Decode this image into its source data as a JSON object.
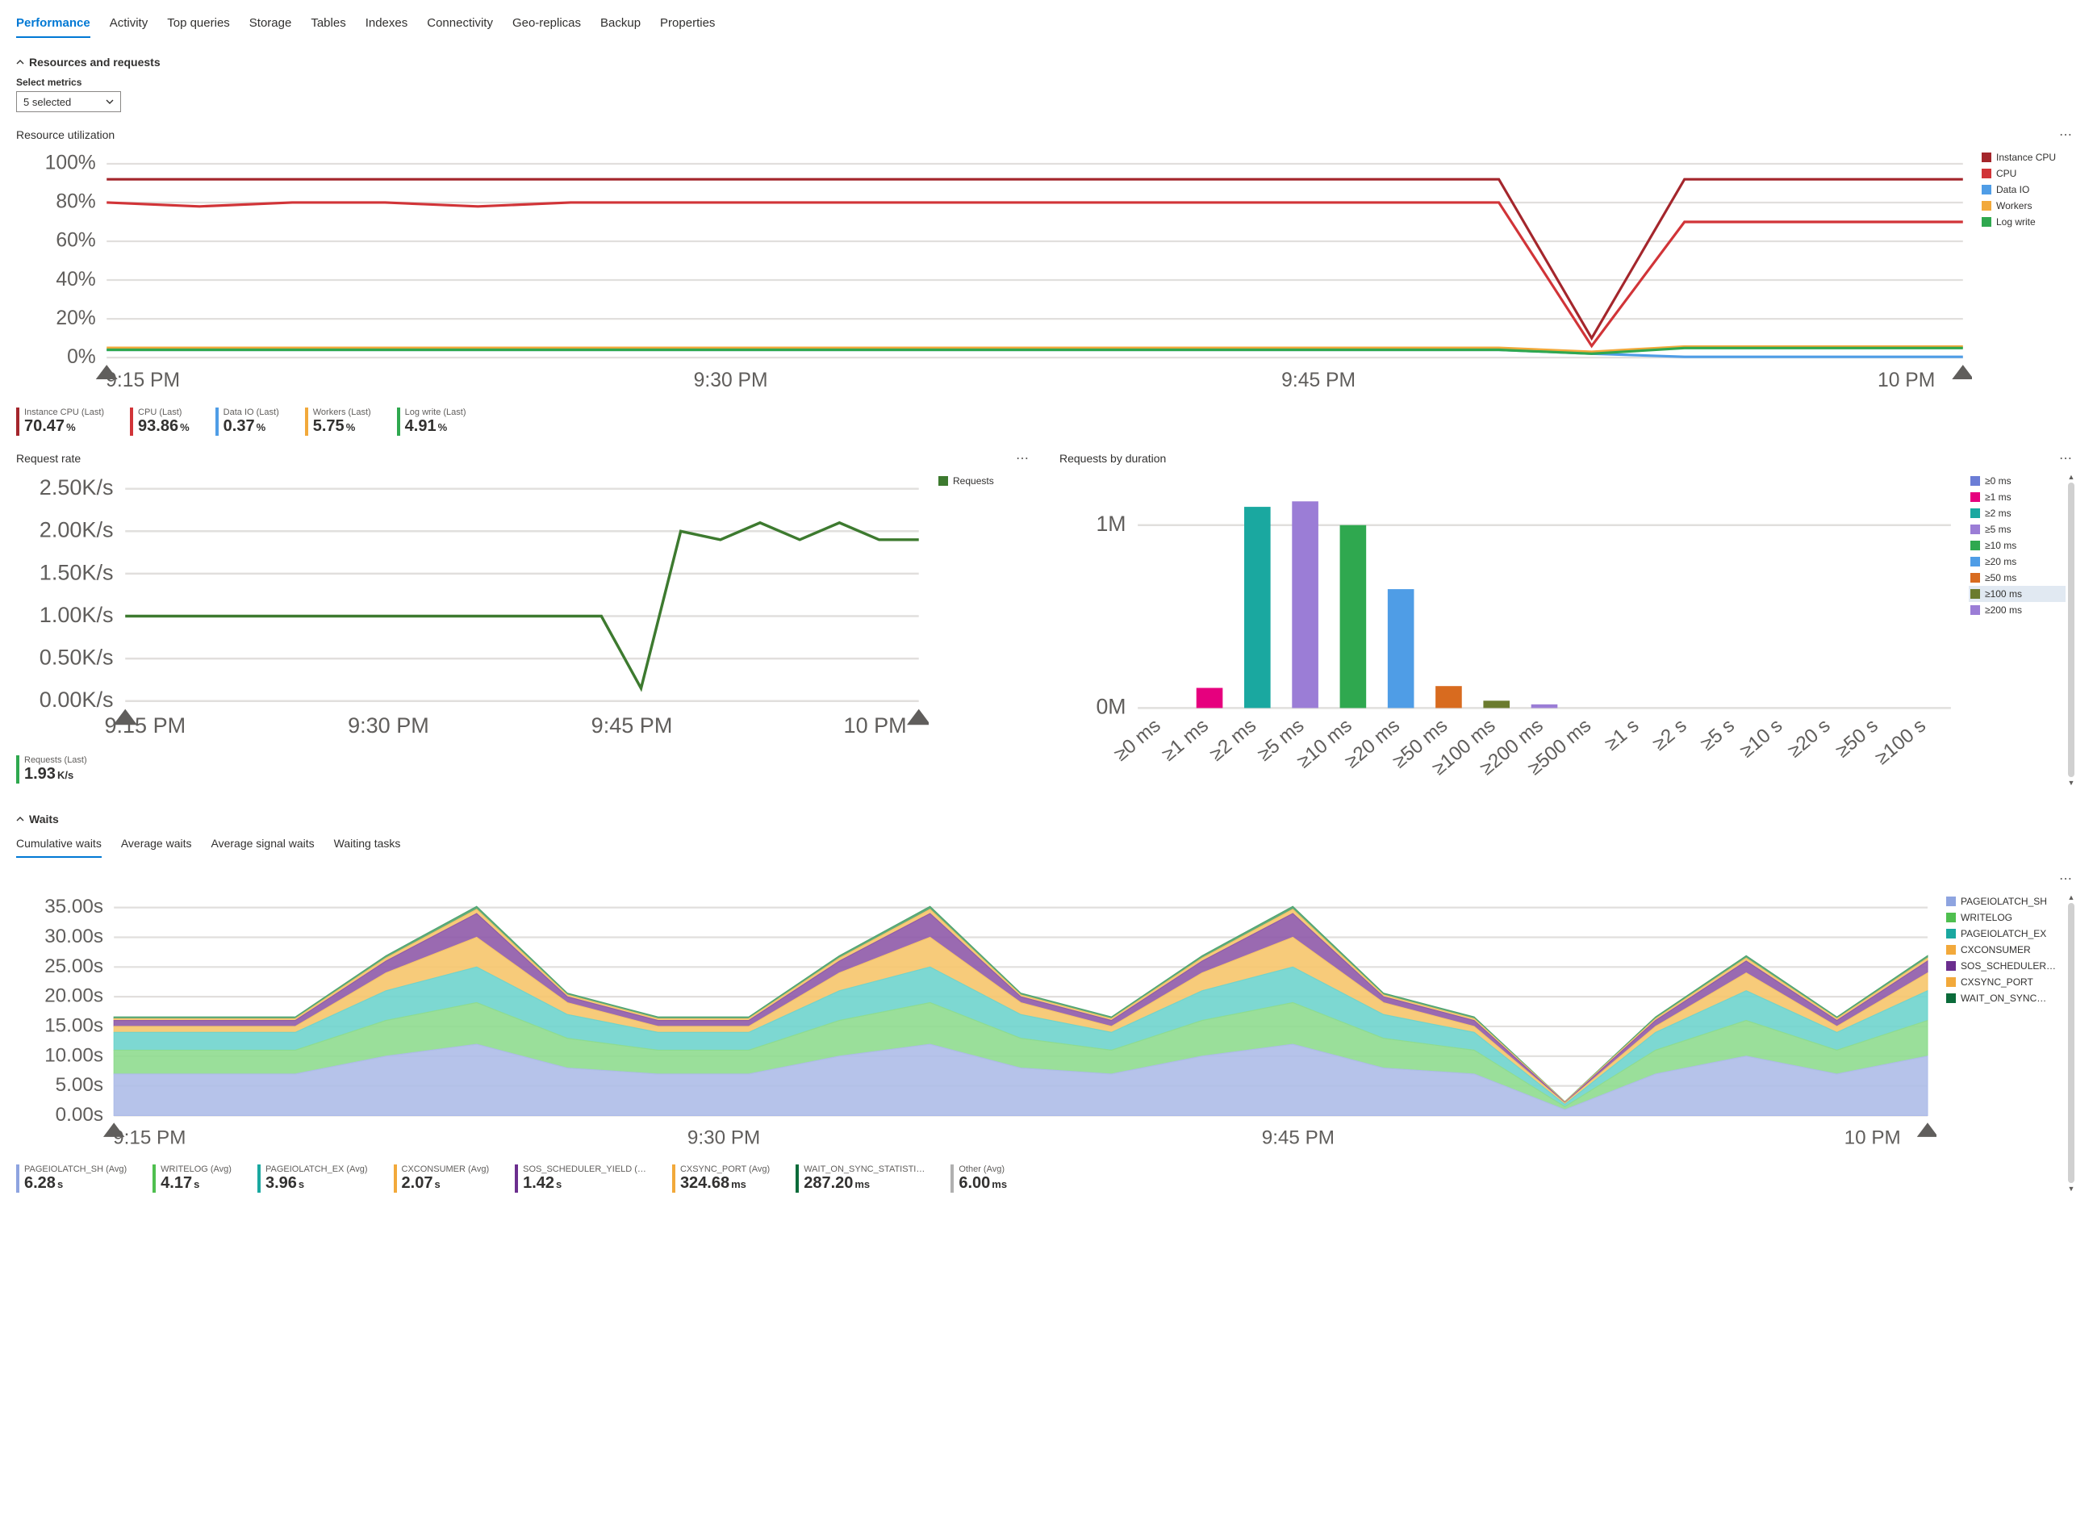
{
  "tabs": [
    "Performance",
    "Activity",
    "Top queries",
    "Storage",
    "Tables",
    "Indexes",
    "Connectivity",
    "Geo-replicas",
    "Backup",
    "Properties"
  ],
  "active_tab": "Performance",
  "section_resources": {
    "title": "Resources and requests",
    "select_label": "Select metrics",
    "select_value": "5 selected"
  },
  "resource_util": {
    "title": "Resource utilization",
    "x_ticks": [
      "9:15 PM",
      "9:30 PM",
      "9:45 PM",
      "10 PM"
    ],
    "legend": [
      {
        "name": "Instance CPU",
        "color": "#a4262c"
      },
      {
        "name": "CPU",
        "color": "#d13438"
      },
      {
        "name": "Data IO",
        "color": "#4f9de6"
      },
      {
        "name": "Workers",
        "color": "#f2a93b"
      },
      {
        "name": "Log write",
        "color": "#2fa84f"
      }
    ],
    "ylabels": [
      "100%",
      "80%",
      "60%",
      "40%",
      "20%",
      "0%"
    ],
    "kpis": [
      {
        "label": "Instance CPU (Last)",
        "value": "70.47",
        "unit": "%",
        "color": "#a4262c"
      },
      {
        "label": "CPU (Last)",
        "value": "93.86",
        "unit": "%",
        "color": "#d13438"
      },
      {
        "label": "Data IO (Last)",
        "value": "0.37",
        "unit": "%",
        "color": "#4f9de6"
      },
      {
        "label": "Workers (Last)",
        "value": "5.75",
        "unit": "%",
        "color": "#f2a93b"
      },
      {
        "label": "Log write (Last)",
        "value": "4.91",
        "unit": "%",
        "color": "#2fa84f"
      }
    ]
  },
  "request_rate": {
    "title": "Request rate",
    "x_ticks": [
      "9:15 PM",
      "9:30 PM",
      "9:45 PM",
      "10 PM"
    ],
    "ylabels": [
      "2.50K/s",
      "2.00K/s",
      "1.50K/s",
      "1.00K/s",
      "0.50K/s",
      "0.00K/s"
    ],
    "legend": [
      {
        "name": "Requests",
        "color": "#3d7a2f"
      }
    ],
    "kpis": [
      {
        "label": "Requests (Last)",
        "value": "1.93",
        "unit": "K/s",
        "color": "#2fa84f"
      }
    ]
  },
  "requests_by_duration": {
    "title": "Requests by duration",
    "ylabels": [
      "1M",
      "0M"
    ],
    "categories": [
      "≥0 ms",
      "≥1 ms",
      "≥2 ms",
      "≥5 ms",
      "≥10 ms",
      "≥20 ms",
      "≥50 ms",
      "≥100 ms",
      "≥200 ms",
      "≥500 ms",
      "≥1 s",
      "≥2 s",
      "≥5 s",
      "≥10 s",
      "≥20 s",
      "≥50 s",
      "≥100 s"
    ],
    "legend": [
      {
        "name": "≥0 ms",
        "color": "#6b7dd6"
      },
      {
        "name": "≥1 ms",
        "color": "#e6007e"
      },
      {
        "name": "≥2 ms",
        "color": "#1aa8a0"
      },
      {
        "name": "≥5 ms",
        "color": "#9b7dd6"
      },
      {
        "name": "≥10 ms",
        "color": "#2fa84f"
      },
      {
        "name": "≥20 ms",
        "color": "#4f9de6"
      },
      {
        "name": "≥50 ms",
        "color": "#d86b1f"
      },
      {
        "name": "≥100 ms",
        "color": "#6b7b2e",
        "highlight": true
      },
      {
        "name": "≥200 ms",
        "color": "#9b7dd6"
      }
    ]
  },
  "waits_section": {
    "title": "Waits",
    "sub_tabs": [
      "Cumulative waits",
      "Average waits",
      "Average signal waits",
      "Waiting tasks"
    ],
    "active_sub_tab": "Cumulative waits"
  },
  "waits_chart": {
    "x_ticks": [
      "9:15 PM",
      "9:30 PM",
      "9:45 PM",
      "10 PM"
    ],
    "ylabels": [
      "35.00s",
      "30.00s",
      "25.00s",
      "20.00s",
      "15.00s",
      "10.00s",
      "5.00s",
      "0.00s"
    ],
    "legend": [
      {
        "name": "PAGEIOLATCH_SH",
        "color": "#8ea4e0"
      },
      {
        "name": "WRITELOG",
        "color": "#4fbf4f"
      },
      {
        "name": "PAGEIOLATCH_EX",
        "color": "#1aa8a0"
      },
      {
        "name": "CXCONSUMER",
        "color": "#f2a93b"
      },
      {
        "name": "SOS_SCHEDULER…",
        "color": "#6b2e8e"
      },
      {
        "name": "CXSYNC_PORT",
        "color": "#f2a93b"
      },
      {
        "name": "WAIT_ON_SYNC…",
        "color": "#0b6b3a"
      }
    ],
    "kpis": [
      {
        "label": "PAGEIOLATCH_SH (Avg)",
        "value": "6.28",
        "unit": "s",
        "color": "#8ea4e0"
      },
      {
        "label": "WRITELOG (Avg)",
        "value": "4.17",
        "unit": "s",
        "color": "#4fbf4f"
      },
      {
        "label": "PAGEIOLATCH_EX (Avg)",
        "value": "3.96",
        "unit": "s",
        "color": "#1aa8a0"
      },
      {
        "label": "CXCONSUMER (Avg)",
        "value": "2.07",
        "unit": "s",
        "color": "#f2a93b"
      },
      {
        "label": "SOS_SCHEDULER_YIELD (…",
        "value": "1.42",
        "unit": "s",
        "color": "#6b2e8e"
      },
      {
        "label": "CXSYNC_PORT (Avg)",
        "value": "324.68",
        "unit": "ms",
        "color": "#f2a93b"
      },
      {
        "label": "WAIT_ON_SYNC_STATISTI…",
        "value": "287.20",
        "unit": "ms",
        "color": "#0b6b3a"
      },
      {
        "label": "Other (Avg)",
        "value": "6.00",
        "unit": "ms",
        "color": "#b0b0b0"
      }
    ]
  },
  "chart_data": [
    {
      "type": "line",
      "title": "Resource utilization",
      "xlabel": "",
      "ylabel": "",
      "ylim": [
        0,
        100
      ],
      "x_ticks": [
        "9:15 PM",
        "9:30 PM",
        "9:45 PM",
        "10 PM"
      ],
      "series": [
        {
          "name": "Instance CPU",
          "color": "#a4262c",
          "approx_values": [
            92,
            92,
            92,
            92,
            92,
            92,
            92,
            92,
            92,
            92,
            92,
            92,
            92,
            92,
            92,
            92,
            10,
            92,
            92,
            92,
            92
          ]
        },
        {
          "name": "CPU",
          "color": "#d13438",
          "approx_values": [
            80,
            78,
            80,
            80,
            78,
            80,
            80,
            80,
            80,
            80,
            80,
            80,
            80,
            80,
            80,
            80,
            6,
            70,
            70,
            70,
            70
          ]
        },
        {
          "name": "Data IO",
          "color": "#4f9de6",
          "approx_values": [
            4,
            4,
            4,
            4,
            4,
            4,
            4,
            4,
            4,
            4,
            4,
            4,
            4,
            4,
            4,
            4,
            2,
            0.4,
            0.4,
            0.4,
            0.4
          ]
        },
        {
          "name": "Workers",
          "color": "#f2a93b",
          "approx_values": [
            5,
            5,
            5,
            5,
            5,
            5,
            5,
            5,
            5,
            5,
            5,
            5,
            5,
            5,
            5,
            5,
            3,
            5.7,
            5.7,
            5.7,
            5.7
          ]
        },
        {
          "name": "Log write",
          "color": "#2fa84f",
          "approx_values": [
            4,
            4,
            4,
            4,
            4,
            4,
            4,
            4,
            4,
            4,
            4,
            4,
            4,
            4,
            4,
            4,
            2,
            4.9,
            4.9,
            4.9,
            4.9
          ]
        }
      ]
    },
    {
      "type": "line",
      "title": "Request rate",
      "xlabel": "",
      "ylabel": "",
      "ylim": [
        0,
        2.5
      ],
      "y_unit": "K/s",
      "x_ticks": [
        "9:15 PM",
        "9:30 PM",
        "9:45 PM",
        "10 PM"
      ],
      "series": [
        {
          "name": "Requests",
          "color": "#3d7a2f",
          "approx_values": [
            1.0,
            1.0,
            1.0,
            1.0,
            1.0,
            1.0,
            1.0,
            1.0,
            1.0,
            1.0,
            1.0,
            1.0,
            1.0,
            0.15,
            2.0,
            1.9,
            2.1,
            1.9,
            2.1,
            1.9,
            1.9
          ]
        }
      ]
    },
    {
      "type": "bar",
      "title": "Requests by duration",
      "xlabel": "",
      "ylabel": "",
      "ylim": [
        0,
        1200000
      ],
      "y_ticks": [
        "0M",
        "1M"
      ],
      "categories": [
        "≥0 ms",
        "≥1 ms",
        "≥2 ms",
        "≥5 ms",
        "≥10 ms",
        "≥20 ms",
        "≥50 ms",
        "≥100 ms",
        "≥200 ms",
        "≥500 ms",
        "≥1 s",
        "≥2 s",
        "≥5 s",
        "≥10 s",
        "≥20 s",
        "≥50 s",
        "≥100 s"
      ],
      "values": [
        0,
        110000,
        1100000,
        1130000,
        1000000,
        650000,
        120000,
        40000,
        20000,
        0,
        0,
        0,
        0,
        0,
        0,
        0,
        0
      ],
      "colors": [
        "#6b7dd6",
        "#e6007e",
        "#1aa8a0",
        "#9b7dd6",
        "#2fa84f",
        "#4f9de6",
        "#d86b1f",
        "#6b7b2e",
        "#9b7dd6",
        "#7a3b8e",
        "#1aa8a0",
        "#4f9de6",
        "#d86b1f",
        "#6b7b2e",
        "#9b7dd6",
        "#7a3b8e",
        "#1aa8a0"
      ]
    },
    {
      "type": "area",
      "title": "Cumulative waits",
      "xlabel": "",
      "ylabel": "",
      "ylim": [
        0,
        35
      ],
      "y_unit": "s",
      "x_ticks": [
        "9:15 PM",
        "9:30 PM",
        "9:45 PM",
        "10 PM"
      ],
      "series": [
        {
          "name": "PAGEIOLATCH_SH",
          "approx_values": [
            7,
            7,
            7,
            10,
            12,
            8,
            7,
            7,
            10,
            12,
            8,
            7,
            10,
            12,
            8,
            7,
            1,
            7,
            10,
            7,
            10
          ]
        },
        {
          "name": "WRITELOG",
          "approx_values": [
            4,
            4,
            4,
            6,
            7,
            5,
            4,
            4,
            6,
            7,
            5,
            4,
            6,
            7,
            5,
            4,
            0.5,
            4,
            6,
            4,
            6
          ]
        },
        {
          "name": "PAGEIOLATCH_EX",
          "approx_values": [
            3,
            3,
            3,
            5,
            6,
            4,
            3,
            3,
            5,
            6,
            4,
            3,
            5,
            6,
            4,
            3,
            0.4,
            3,
            5,
            3,
            5
          ]
        },
        {
          "name": "CXCONSUMER",
          "approx_values": [
            1,
            1,
            1,
            3,
            5,
            2,
            1,
            1,
            3,
            5,
            2,
            1,
            3,
            5,
            2,
            1,
            0.2,
            1,
            3,
            1,
            3
          ]
        },
        {
          "name": "SOS_SCHEDULER_YIELD",
          "approx_values": [
            1,
            1,
            1,
            2,
            4,
            1,
            1,
            1,
            2,
            4,
            1,
            1,
            2,
            4,
            1,
            1,
            0.1,
            1,
            2,
            1,
            2
          ]
        },
        {
          "name": "CXSYNC_PORT",
          "approx_values": [
            0.3,
            0.3,
            0.3,
            0.5,
            0.7,
            0.3,
            0.3,
            0.3,
            0.5,
            0.7,
            0.3,
            0.3,
            0.5,
            0.7,
            0.3,
            0.3,
            0.1,
            0.3,
            0.5,
            0.3,
            0.5
          ]
        },
        {
          "name": "WAIT_ON_SYNC_STATISTICS",
          "approx_values": [
            0.3,
            0.3,
            0.3,
            0.4,
            0.5,
            0.3,
            0.3,
            0.3,
            0.4,
            0.5,
            0.3,
            0.3,
            0.4,
            0.5,
            0.3,
            0.3,
            0.05,
            0.3,
            0.4,
            0.3,
            0.4
          ]
        }
      ]
    }
  ]
}
